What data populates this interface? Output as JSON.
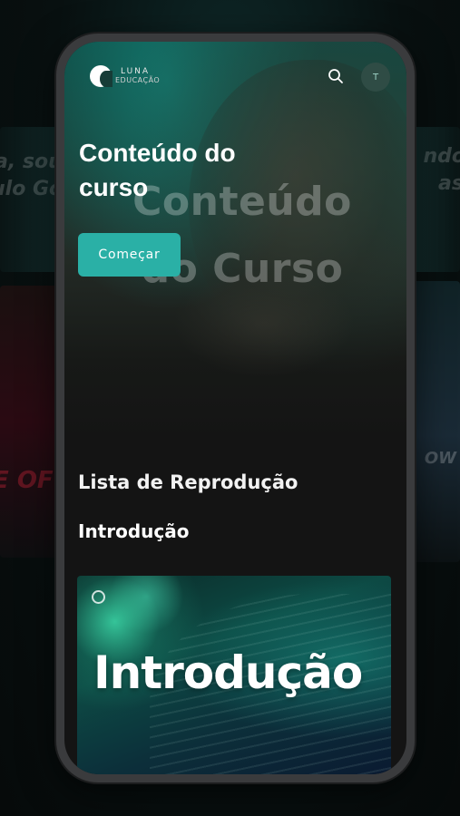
{
  "brand": {
    "logo_line1": "LUNA",
    "logo_line2": "EDUCAÇÃO"
  },
  "header": {
    "search_icon": "search-icon",
    "avatar_initial": "T"
  },
  "hero": {
    "title": "Conteúdo do curso",
    "background_title": "Conteúdo do Curso",
    "start_button": "Começar"
  },
  "playlist": {
    "heading": "Lista de Reprodução",
    "section": "Introdução",
    "videos": [
      {
        "thumbnail_title": "Introdução"
      }
    ]
  },
  "background": {
    "left_text_1": "a, sou",
    "left_text_2": "ulo Go",
    "right_text_1": "ndo",
    "right_text_2": "as",
    "left_text_3": "E OF CR",
    "right_text_3": "OW"
  },
  "colors": {
    "accent": "#2ab0a6",
    "screen_bg": "#141414",
    "phone_frame": "#3a3b3d"
  }
}
